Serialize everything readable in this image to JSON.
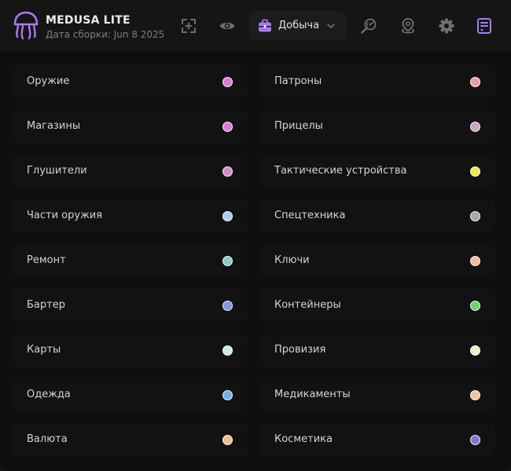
{
  "app": {
    "title": "MEDUSA LITE",
    "build_date": "Дата сборки: Jun 8 2025"
  },
  "header": {
    "icons": [
      {
        "name": "screenshot-plus-icon"
      },
      {
        "name": "eye-icon"
      },
      {
        "name": "radar-search-icon"
      },
      {
        "name": "map-pin-icon"
      },
      {
        "name": "gear-icon"
      },
      {
        "name": "loot-list-icon",
        "active": true
      }
    ],
    "mode_select": {
      "icon": "briefcase-icon",
      "value": "Добыча"
    }
  },
  "colors": {
    "accent": "#9b6ef3",
    "icon_default": "#6f6f6f"
  },
  "categories": {
    "left": [
      {
        "label": "Оружие",
        "color": "#e07ad9"
      },
      {
        "label": "Магазины",
        "color": "#e07ad9"
      },
      {
        "label": "Глушители",
        "color": "#d58cc9"
      },
      {
        "label": "Части оружия",
        "color": "#a9cdea"
      },
      {
        "label": "Ремонт",
        "color": "#8cc9c2"
      },
      {
        "label": "Бартер",
        "color": "#7d96e6"
      },
      {
        "label": "Карты",
        "color": "#c5efe0"
      },
      {
        "label": "Одежда",
        "color": "#6fb0ea"
      },
      {
        "label": "Валюта",
        "color": "#efbd8f"
      }
    ],
    "right": [
      {
        "label": "Патроны",
        "color": "#ec9ea8"
      },
      {
        "label": "Прицелы",
        "color": "#c8a3c3"
      },
      {
        "label": "Тактические устройства",
        "color": "#f0ea4e"
      },
      {
        "label": "Спецтехника",
        "color": "#a8a8a8"
      },
      {
        "label": "Ключи",
        "color": "#eebf94"
      },
      {
        "label": "Контейнеры",
        "color": "#6ed36e"
      },
      {
        "label": "Провизия",
        "color": "#efedc5"
      },
      {
        "label": "Медикаменты",
        "color": "#efc2a0"
      },
      {
        "label": "Косметика",
        "color": "#8574cf"
      }
    ]
  }
}
